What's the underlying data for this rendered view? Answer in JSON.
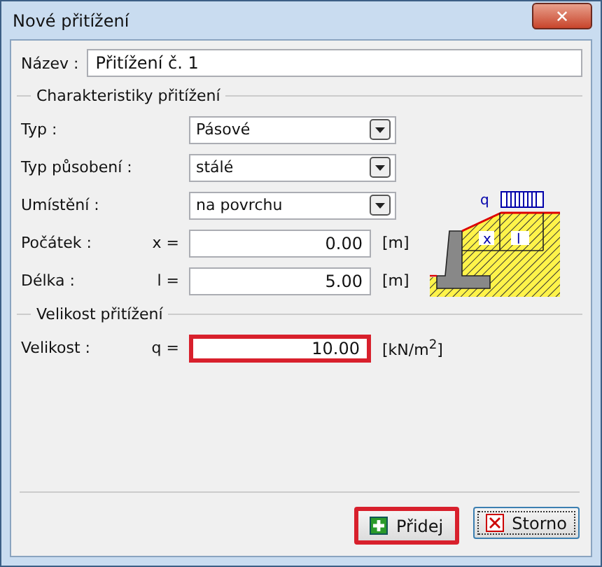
{
  "window": {
    "title": "Nové přitížení",
    "close_icon": "✕"
  },
  "name": {
    "label": "Název :",
    "value": "Přitížení č. 1"
  },
  "characteristics": {
    "title": "Charakteristiky přitížení",
    "rows": [
      {
        "kind": "select",
        "label": "Typ :",
        "value": "Pásové"
      },
      {
        "kind": "select",
        "label": "Typ působení :",
        "value": "stálé"
      },
      {
        "kind": "select",
        "label": "Umístění :",
        "value": "na povrchu"
      },
      {
        "kind": "number",
        "label": "Počátek :",
        "symbol": "x =",
        "value": "0.00",
        "unit": "[m]",
        "highlighted": false
      },
      {
        "kind": "number",
        "label": "Délka :",
        "symbol": "l =",
        "value": "5.00",
        "unit": "[m]",
        "highlighted": false
      }
    ],
    "diagram": {
      "q": "q",
      "x": "x",
      "l": "l"
    }
  },
  "magnitude": {
    "title": "Velikost přitížení",
    "rows": [
      {
        "kind": "number",
        "label": "Velikost :",
        "symbol": "q =",
        "value": "10.00",
        "unit": "[kN/m$^{2}$]",
        "highlighted": true
      }
    ]
  },
  "buttons": [
    {
      "kind": "add",
      "label": "Přidej",
      "highlighted": true,
      "focused": false
    },
    {
      "kind": "cancel",
      "label": "Storno",
      "highlighted": false,
      "focused": true
    }
  ]
}
